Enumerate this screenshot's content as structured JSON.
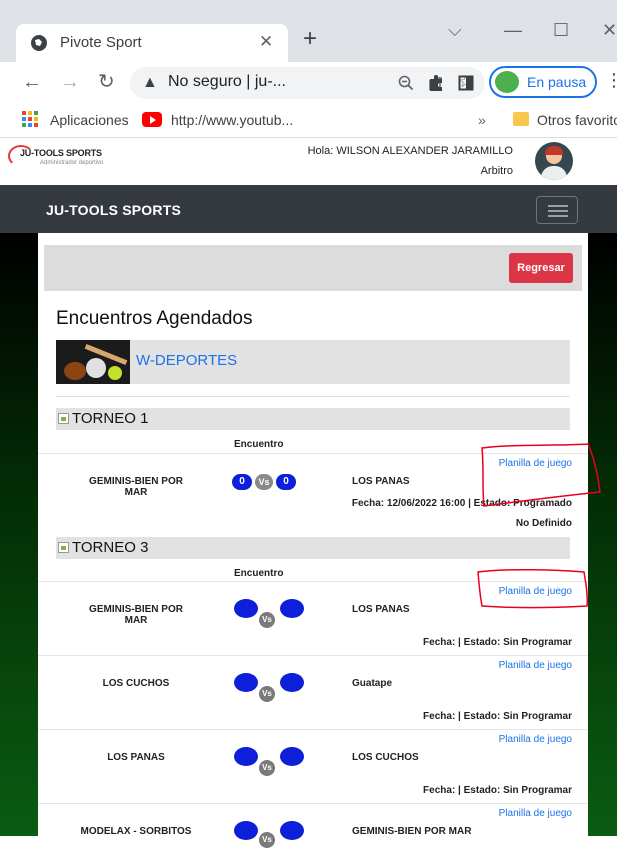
{
  "browser": {
    "tab_title": "Pivote Sport",
    "tab_close": "✕",
    "new_tab": "+",
    "window_controls": {
      "chevron": "⌵",
      "minimize": "—",
      "maximize": "☐",
      "close": "✕"
    },
    "address": "No seguro | ju-...",
    "profile_status": "En pausa",
    "bookmarks": {
      "apps": "Aplicaciones",
      "youtube": "http://www.youtub...",
      "more": "»",
      "others": "Otros favorito"
    }
  },
  "header": {
    "logo_text": "JU-TOOLS SPORTS",
    "logo_sub": "Administrador deportivo",
    "greeting": "Hola: WILSON ALEXANDER JARAMILLO",
    "role": "Arbitro"
  },
  "navbar": {
    "brand": "JU-TOOLS SPORTS"
  },
  "panel": {
    "back_button": "Regresar"
  },
  "page": {
    "title": "Encuentros Agendados",
    "organization": "W-DEPORTES"
  },
  "tournaments": [
    {
      "name": "TORNEO 1",
      "column_header": "Encuentro",
      "matches": [
        {
          "home": "GEMINIS-BIEN POR MAR",
          "away": "LOS PANAS",
          "home_score": "0",
          "vs": "Vs",
          "away_score": "0",
          "link": "Planilla de juego",
          "info": "Fecha: 12/06/2022 16:00 | Estado: Programado",
          "extra": "No Definido"
        }
      ]
    },
    {
      "name": "TORNEO 3",
      "column_header": "Encuentro",
      "matches": [
        {
          "home": "GEMINIS-BIEN POR MAR",
          "away": "LOS PANAS",
          "vs": "Vs",
          "link": "Planilla de juego",
          "info": "Fecha: | Estado: Sin Programar"
        },
        {
          "home": "LOS CUCHOS",
          "away": "Guatape",
          "vs": "Vs",
          "link": "Planilla de juego",
          "info": "Fecha: | Estado: Sin Programar"
        },
        {
          "home": "LOS PANAS",
          "away": "LOS CUCHOS",
          "vs": "Vs",
          "link": "Planilla de juego",
          "info": "Fecha: | Estado: Sin Programar"
        },
        {
          "home": "MODELAX - SORBITOS",
          "away": "GEMINIS-BIEN POR MAR",
          "vs": "Vs",
          "link": "Planilla de juego"
        }
      ]
    }
  ],
  "colors": {
    "accent_blue": "#0d1fd9",
    "link_blue": "#1a73e8",
    "danger": "#dc3545",
    "navbar": "#343a40",
    "annotation": "#e8001c"
  }
}
